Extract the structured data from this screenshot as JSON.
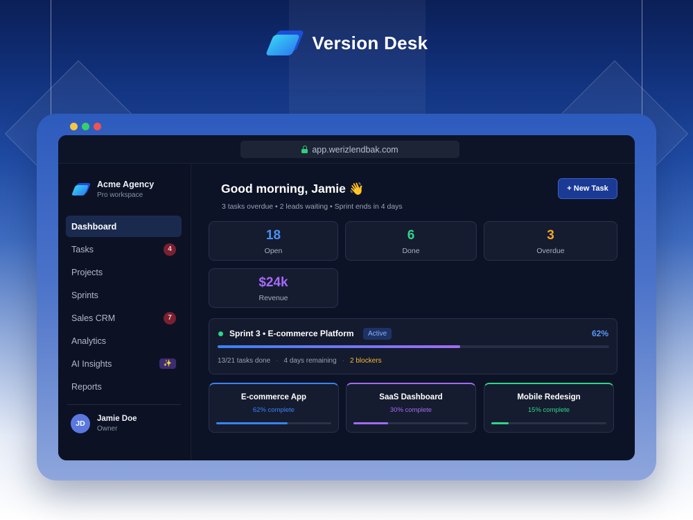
{
  "brand": {
    "name": "Version Desk"
  },
  "browser": {
    "url": "app.werizlendbak.com"
  },
  "sidebar": {
    "workspace_name": "Acme Agency",
    "workspace_plan": "Pro workspace",
    "items": [
      {
        "label": "Dashboard",
        "active": true
      },
      {
        "label": "Tasks",
        "badge": "4"
      },
      {
        "label": "Projects"
      },
      {
        "label": "Sprints"
      },
      {
        "label": "Sales CRM",
        "badge": "7"
      },
      {
        "label": "Analytics"
      },
      {
        "label": "AI Insights",
        "badge": "✨"
      },
      {
        "label": "Reports"
      }
    ],
    "user": {
      "initials": "JD",
      "name": "Jamie Doe",
      "role": "Owner"
    }
  },
  "main": {
    "greeting": "Good morning, Jamie 👋",
    "subline": "3 tasks overdue • 2 leads waiting • Sprint ends in 4 days",
    "new_task_label": "+ New Task",
    "stats": [
      {
        "value": "18",
        "label": "Open",
        "color": "#4b8ff5"
      },
      {
        "value": "6",
        "label": "Done",
        "color": "#2fd58a"
      },
      {
        "value": "3",
        "label": "Overdue",
        "color": "#f5a524"
      },
      {
        "value": "$24k",
        "label": "Revenue",
        "color": "#a56af7"
      }
    ],
    "sprint": {
      "title": "Sprint 3 • E-commerce Platform",
      "status": "Active",
      "percent_label": "62%",
      "progress": 0.62,
      "tasks_done": "13/21 tasks done",
      "remaining": "4 days remaining",
      "blockers": "2 blockers"
    },
    "projects": [
      {
        "name": "E-commerce App",
        "percent_label": "62% complete",
        "progress": 0.62,
        "color": "#3b82f6"
      },
      {
        "name": "SaaS Dashboard",
        "percent_label": "30% complete",
        "progress": 0.3,
        "color": "#a56af7"
      },
      {
        "name": "Mobile Redesign",
        "percent_label": "15% complete",
        "progress": 0.15,
        "color": "#2fd58a"
      }
    ]
  }
}
